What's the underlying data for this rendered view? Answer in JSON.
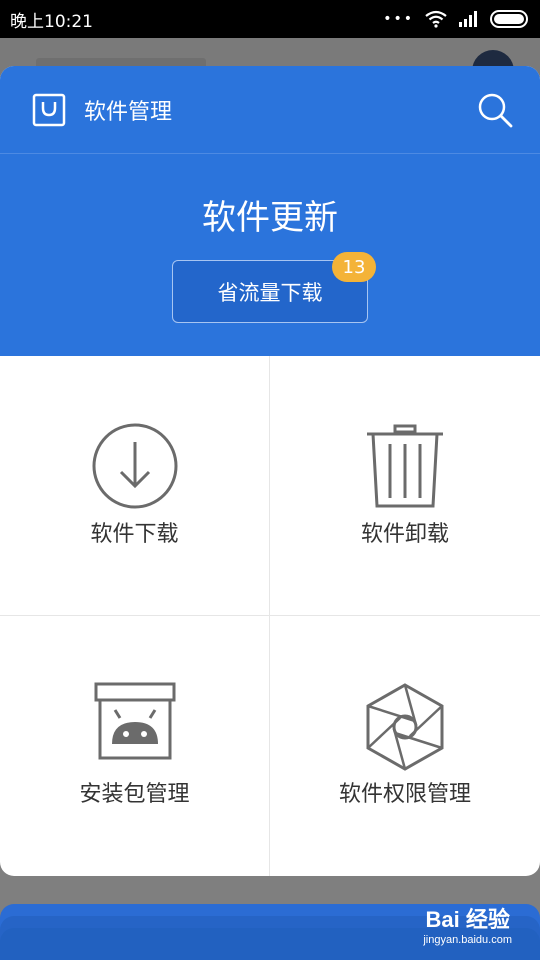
{
  "status_bar": {
    "time": "晚上10:21",
    "signal_dots": "•••"
  },
  "sheet": {
    "title": "软件管理",
    "header_icon": "shopping-bag-icon",
    "search_icon": "search-icon",
    "update_title": "软件更新",
    "download_button": "省流量下载",
    "badge_count": "13",
    "colors": {
      "header_blue": "#2b74dc",
      "button_blue": "#2366cb",
      "badge_orange": "#f4b338"
    }
  },
  "grid": [
    {
      "label": "软件下载",
      "icon": "download-icon"
    },
    {
      "label": "软件卸载",
      "icon": "trash-icon"
    },
    {
      "label": "安装包管理",
      "icon": "android-package-icon"
    },
    {
      "label": "软件权限管理",
      "icon": "hexagon-permission-icon"
    }
  ],
  "watermark": {
    "brand": "Bai 经验",
    "url": "jingyan.baidu.com"
  }
}
